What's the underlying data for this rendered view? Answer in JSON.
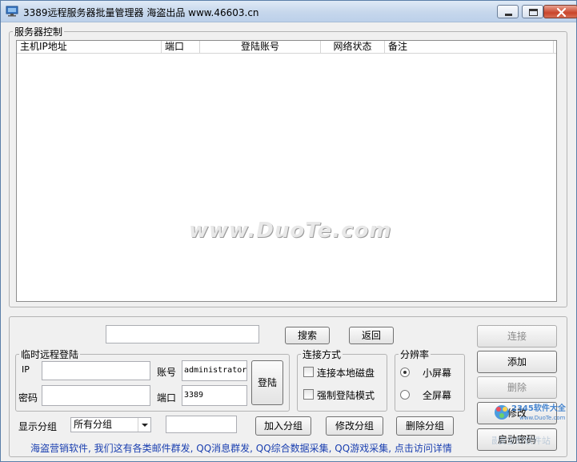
{
  "window": {
    "title": "3389远程服务器批量管理器 海盗出品  www.46603.cn",
    "controls": {
      "minimize": "minimize",
      "maximize": "maximize",
      "close": "close"
    }
  },
  "server_control": {
    "legend": "服务器控制",
    "columns": [
      "主机IP地址",
      "端口",
      "登陆账号",
      "网络状态",
      "备注"
    ],
    "rows": []
  },
  "watermark": "www.DuoTe.com",
  "search": {
    "value": "",
    "search_label": "搜索",
    "back_label": "返回"
  },
  "temp_login": {
    "legend": "临时远程登陆",
    "ip_label": "IP",
    "ip_value": "",
    "account_label": "账号",
    "account_value": "administrator",
    "password_label": "密码",
    "password_value": "",
    "port_label": "端口",
    "port_value": "3389",
    "login_label": "登陆"
  },
  "connect_mode": {
    "legend": "连接方式",
    "local_disk_label": "连接本地磁盘",
    "local_disk_checked": false,
    "force_login_label": "强制登陆模式",
    "force_login_checked": false
  },
  "resolution": {
    "legend": "分辨率",
    "small_label": "小屏幕",
    "small_selected": true,
    "full_label": "全屏幕",
    "full_selected": false
  },
  "actions": {
    "connect": "连接",
    "add": "添加",
    "delete": "删除",
    "modify": "修改",
    "launch_password": "启动密码"
  },
  "group": {
    "label": "显示分组",
    "selected": "所有分组",
    "name_value": "",
    "add_label": "加入分组",
    "modify_label": "修改分组",
    "delete_label": "删除分组"
  },
  "footer_link": "海盗营销软件, 我们这有各类邮件群发, QQ消息群发, QQ综合数据采集, QQ游戏采集, 点击访问详情",
  "corner_logo": {
    "brand": "2345软件大全",
    "url": "www.DuoTe.com",
    "caption": "国内最安全的软件站"
  }
}
